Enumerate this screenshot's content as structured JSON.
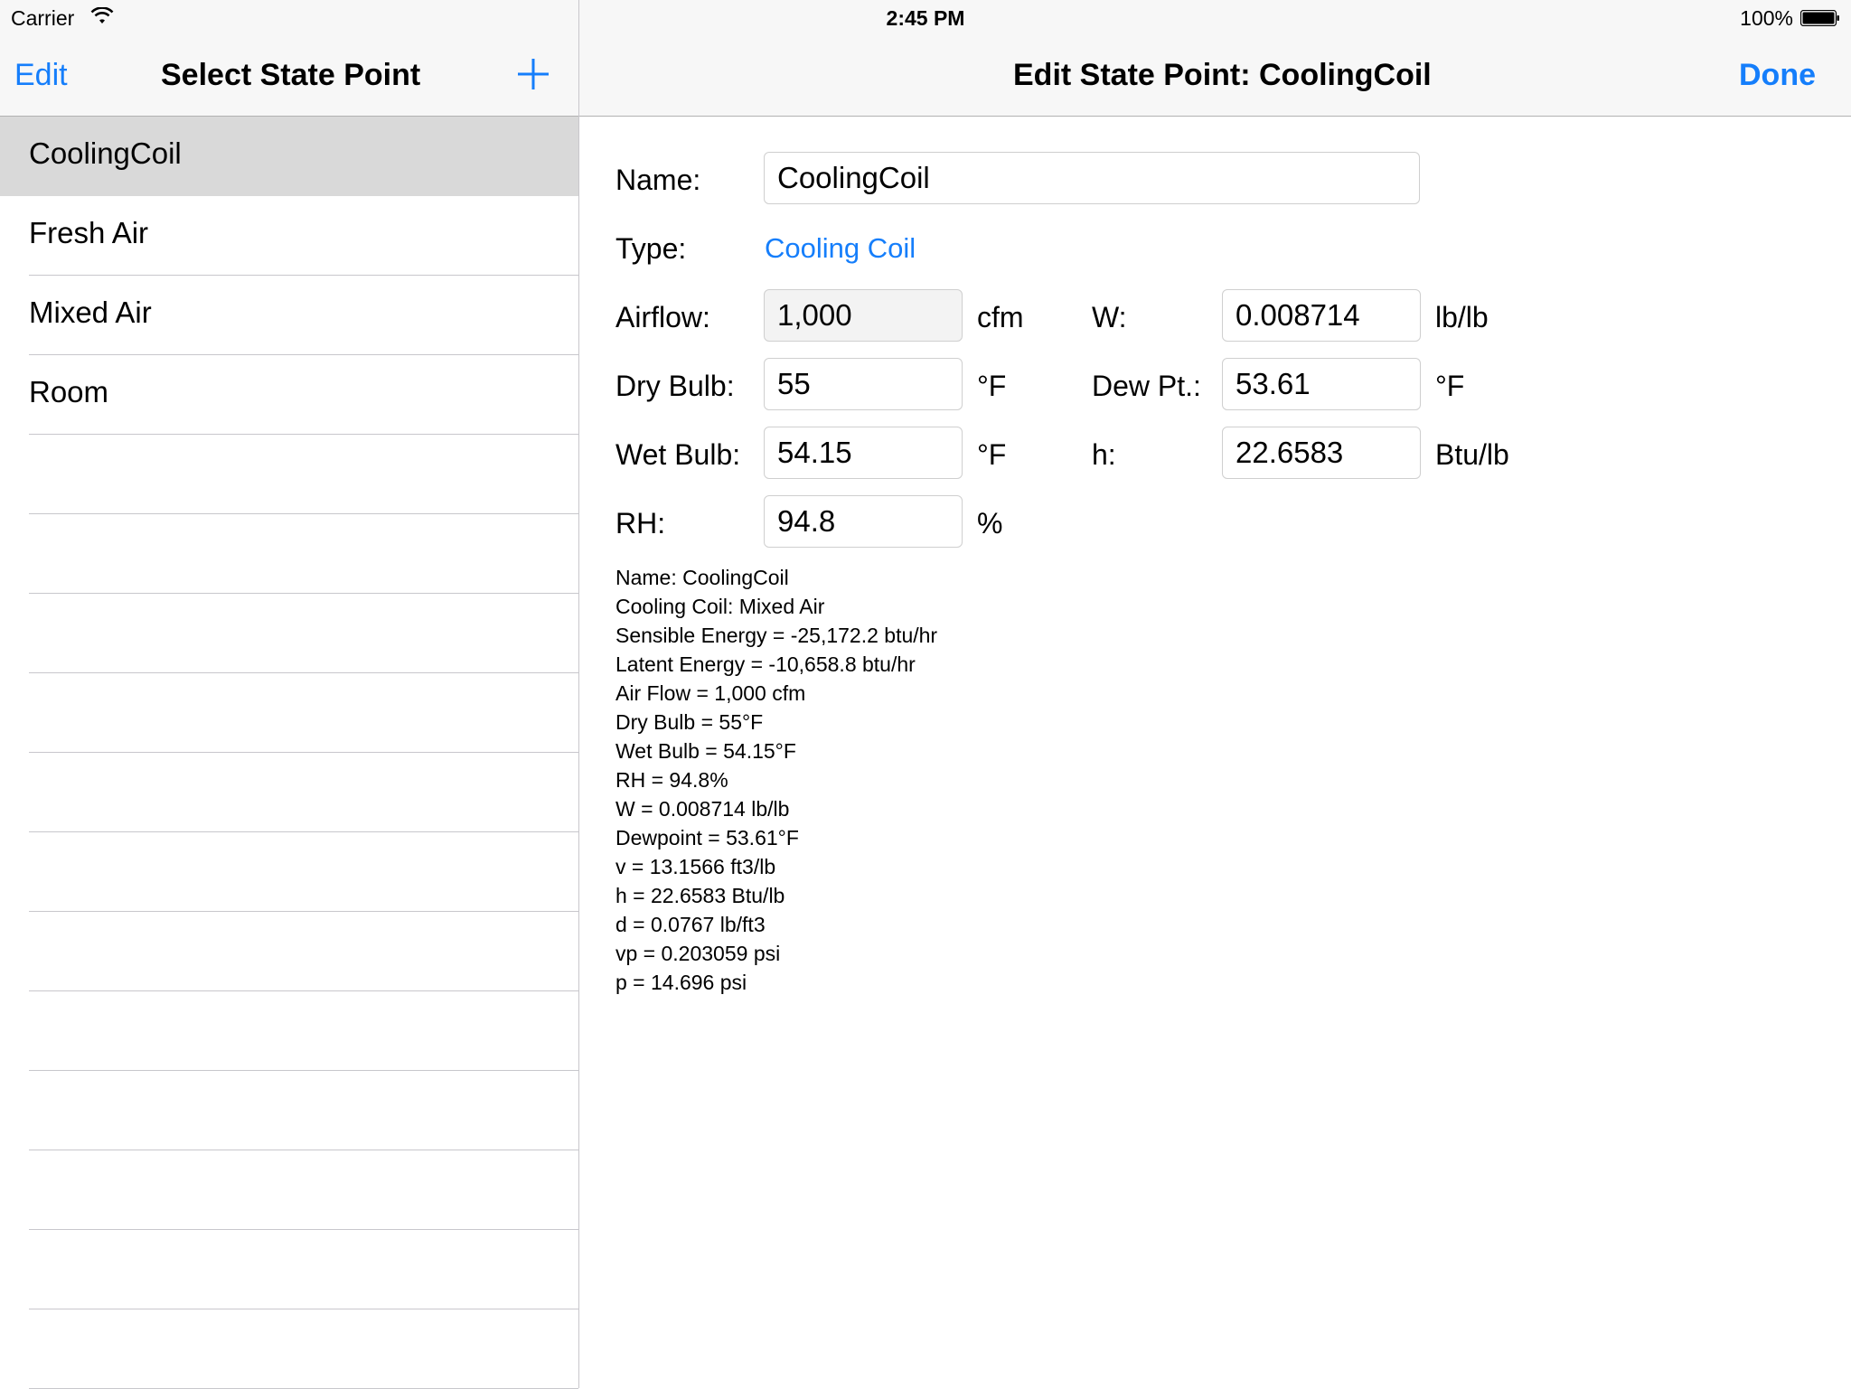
{
  "status_bar": {
    "carrier": "Carrier",
    "time": "2:45 PM",
    "battery": "100%"
  },
  "master": {
    "nav": {
      "edit_label": "Edit",
      "title": "Select State Point"
    },
    "items": [
      {
        "label": "CoolingCoil",
        "selected": true
      },
      {
        "label": "Fresh Air",
        "selected": false
      },
      {
        "label": "Mixed Air",
        "selected": false
      },
      {
        "label": "Room",
        "selected": false
      }
    ]
  },
  "detail": {
    "nav": {
      "title": "Edit State Point: CoolingCoil",
      "done_label": "Done"
    },
    "form": {
      "name_label": "Name:",
      "name_value": "CoolingCoil",
      "type_label": "Type:",
      "type_value": "Cooling Coil",
      "airflow_label": "Airflow:",
      "airflow_value": "1,000",
      "airflow_unit": "cfm",
      "drybulb_label": "Dry Bulb:",
      "drybulb_value": "55",
      "drybulb_unit": "°F",
      "wetbulb_label": "Wet Bulb:",
      "wetbulb_value": "54.15",
      "wetbulb_unit": "°F",
      "rh_label": "RH:",
      "rh_value": "94.8",
      "rh_unit": "%",
      "w_label": "W:",
      "w_value": "0.008714",
      "w_unit": "lb/lb",
      "dewpt_label": "Dew Pt.:",
      "dewpt_value": "53.61",
      "dewpt_unit": "°F",
      "h_label": "h:",
      "h_value": "22.6583",
      "h_unit": "Btu/lb"
    },
    "results": [
      "Name: CoolingCoil",
      "Cooling Coil: Mixed Air",
      "Sensible Energy = -25,172.2 btu/hr",
      "Latent Energy = -10,658.8 btu/hr",
      "Air Flow = 1,000 cfm",
      "Dry Bulb = 55°F",
      "Wet Bulb = 54.15°F",
      "RH = 94.8%",
      "W = 0.008714 lb/lb",
      "Dewpoint = 53.61°F",
      "v = 13.1566 ft3/lb",
      "h = 22.6583 Btu/lb",
      "d = 0.0767 lb/ft3",
      "vp = 0.203059 psi",
      "p = 14.696 psi"
    ]
  },
  "colors": {
    "accent": "#157efb",
    "selected_row": "#d9d9d9",
    "navbar": "#f7f7f7"
  },
  "icons": {
    "wifi": "wifi-icon",
    "battery": "battery-icon",
    "add": "plus-icon"
  }
}
